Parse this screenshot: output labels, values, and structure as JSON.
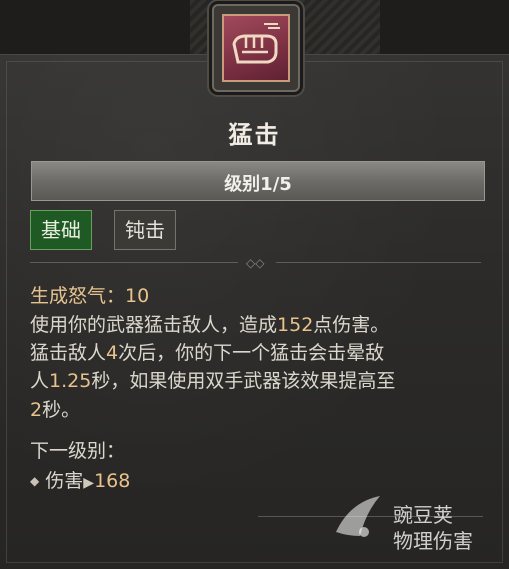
{
  "skill": {
    "title": "猛击",
    "level": "级别1/5",
    "tags": [
      "基础",
      "钝击"
    ]
  },
  "description": {
    "resource_label": "生成怒气：",
    "resource_value": "10",
    "line1_a": "使用你的武器猛击敌人，造成",
    "line1_num": "152",
    "line1_b": "点伤害。",
    "line2_a": "猛击敌人",
    "line2_num": "4",
    "line2_b": "次后，你的下一个猛击会击晕敌",
    "line3_a": "人",
    "line3_num": "1.25",
    "line3_b": "秒，如果使用双手武器该效果提高至",
    "line4_num": "2",
    "line4_b": "秒。"
  },
  "next_level": {
    "heading": "下一级别：",
    "stat_label": "伤害",
    "stat_value": "168"
  },
  "watermark": {
    "line1": "豌豆荚",
    "line2": "物理伤害"
  },
  "colors": {
    "basic_tag": "#1f5a24",
    "number": "#e9c28e"
  }
}
